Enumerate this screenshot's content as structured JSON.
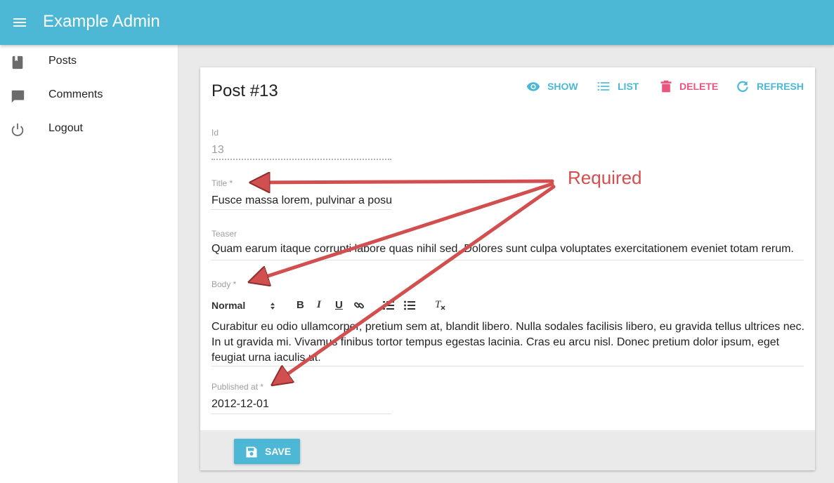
{
  "app": {
    "title": "Example Admin"
  },
  "sidebar": {
    "items": [
      {
        "label": "Posts",
        "icon": "book-icon"
      },
      {
        "label": "Comments",
        "icon": "comment-icon"
      },
      {
        "label": "Logout",
        "icon": "power-icon"
      }
    ]
  },
  "page": {
    "title": "Post #13",
    "actions": {
      "show": "SHOW",
      "list": "LIST",
      "delete": "DELETE",
      "refresh": "REFRESH"
    }
  },
  "form": {
    "id": {
      "label": "Id",
      "value": "13"
    },
    "title": {
      "label": "Title *",
      "value": "Fusce massa lorem, pulvinar a posuere ut, accumsan ac nisi."
    },
    "teaser": {
      "label": "Teaser",
      "value": "Quam earum itaque corrupti labore quas nihil sed. Dolores sunt culpa voluptates exercitationem eveniet totam rerum."
    },
    "body": {
      "label": "Body *",
      "format": "Normal",
      "value": "Curabitur eu odio ullamcorper, pretium sem at, blandit libero. Nulla sodales facilisis libero, eu gravida tellus ultrices nec. In ut gravida mi. Vivamus finibus tortor tempus egestas lacinia. Cras eu arcu nisl. Donec pretium dolor ipsum, eget feugiat urna iaculis ut."
    },
    "published_at": {
      "label": "Published at *",
      "value": "2012-12-01"
    }
  },
  "toolbar": {
    "save_label": "SAVE"
  },
  "annotation": {
    "text": "Required"
  },
  "colors": {
    "primary": "#4cb8d5",
    "danger": "#e8567e",
    "annotation": "#d24f50"
  }
}
